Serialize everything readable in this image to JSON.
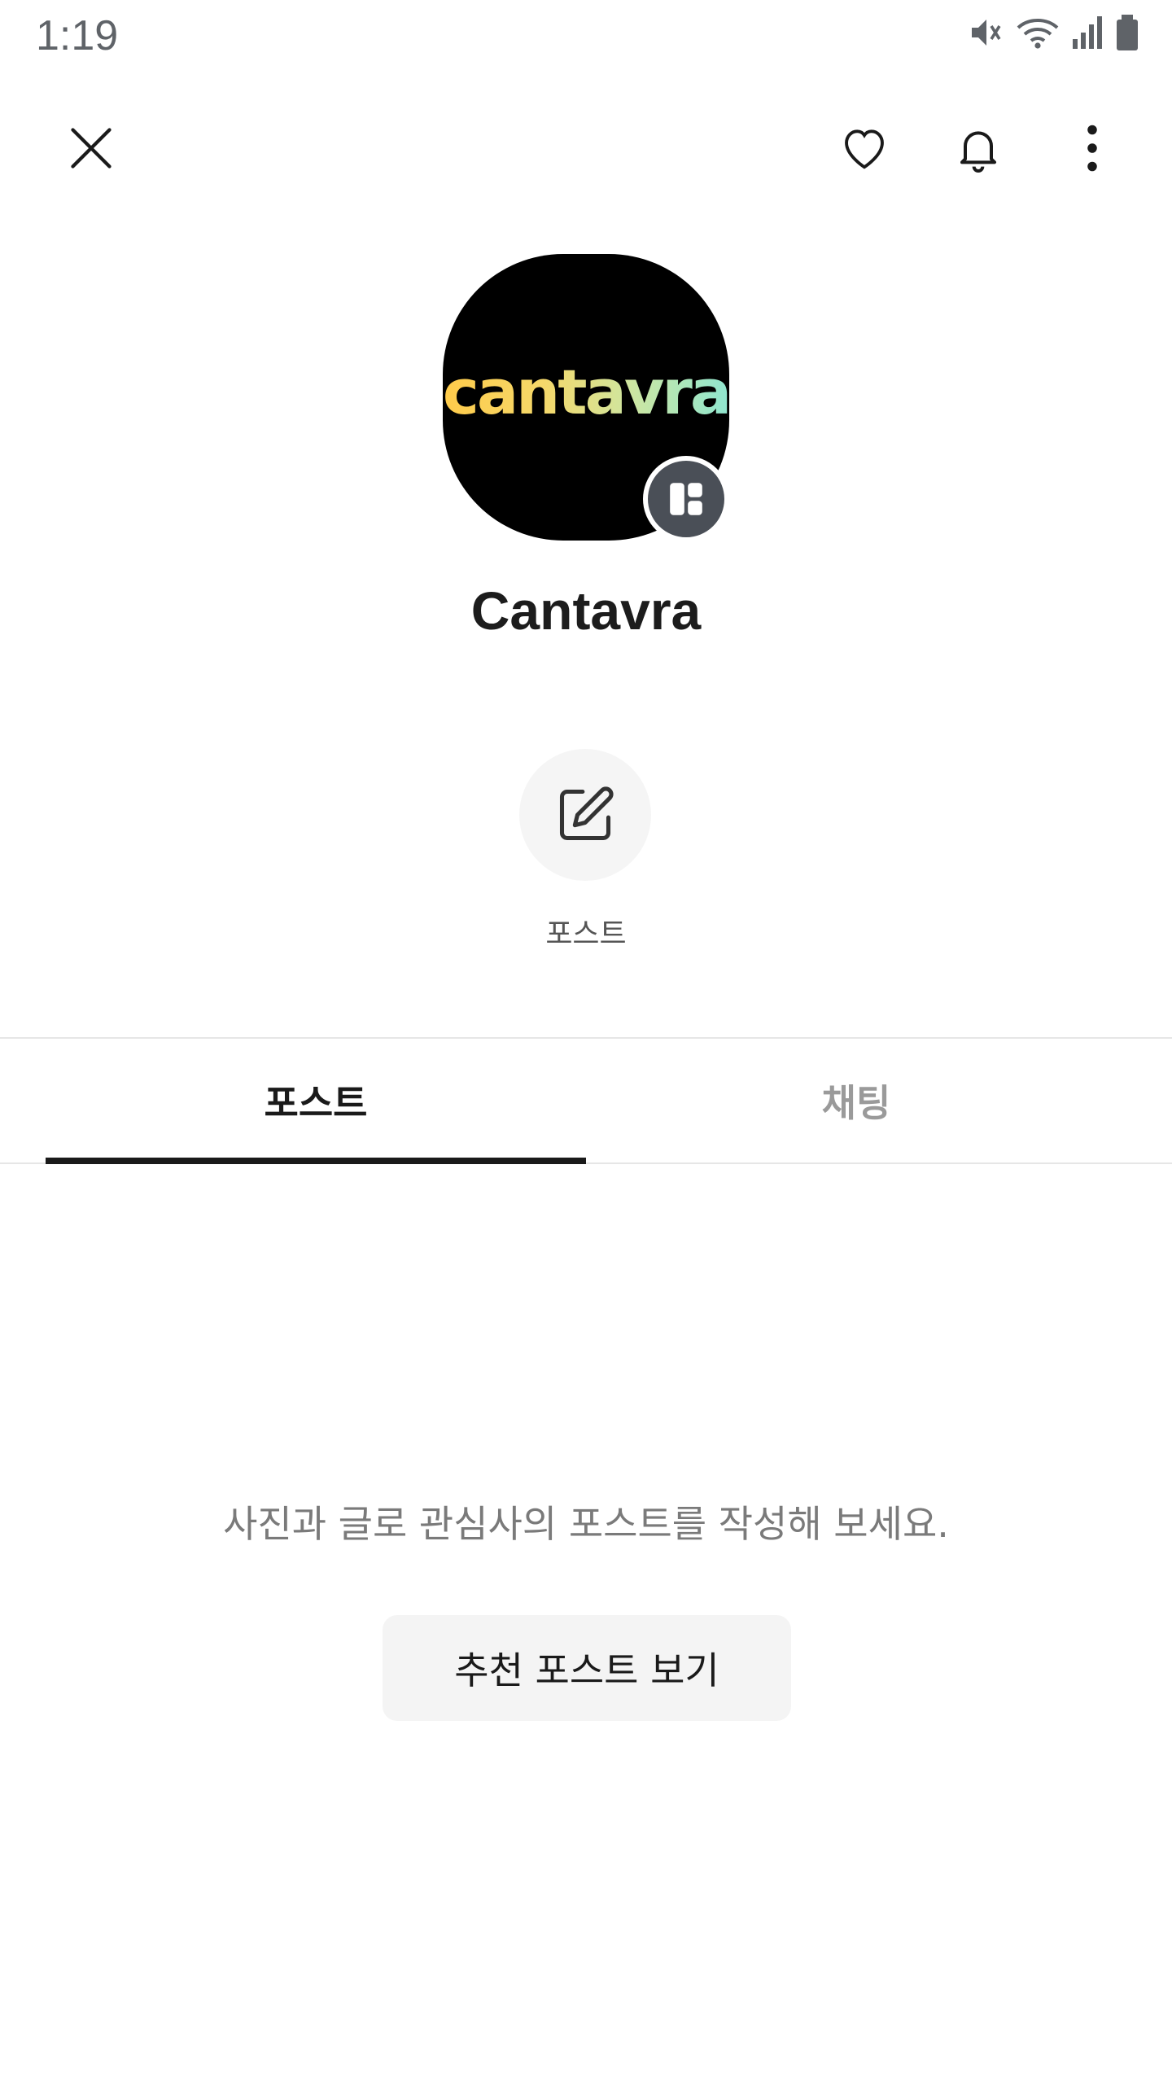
{
  "status_bar": {
    "time": "1:19",
    "icons": [
      "mute-icon",
      "wifi-icon",
      "signal-icon",
      "battery-icon"
    ]
  },
  "toolbar": {
    "close_icon": "close-icon",
    "like_icon": "heart-icon",
    "notify_icon": "bell-icon",
    "more_icon": "more-vert-icon"
  },
  "profile": {
    "logo_text": "cantavra",
    "name": "Cantavra",
    "badge_icon": "layout-icon"
  },
  "actions": {
    "post_label": "포스트",
    "post_icon": "edit-icon"
  },
  "tabs": [
    {
      "label": "포스트",
      "active": true
    },
    {
      "label": "채팅",
      "active": false
    }
  ],
  "empty_state": {
    "message": "사진과 글로 관심사의 포스트를 작성해 보세요.",
    "button_label": "추천 포스트 보기"
  },
  "colors": {
    "background": "#ffffff",
    "tab_indicator": "#1a1a1a",
    "badge": "#4a4f57",
    "button_bg": "#f4f4f4"
  }
}
